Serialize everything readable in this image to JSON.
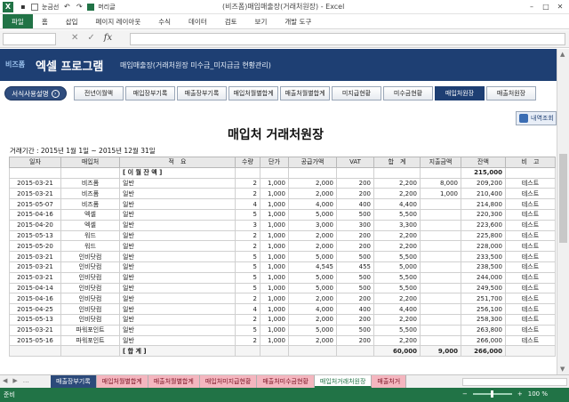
{
  "titlebar": {
    "app_icon": "X",
    "qat_gridlines": "눈금선",
    "qat_header": "머리글",
    "title": "(비즈폼)매입매출장(거래처원장) - Excel",
    "min": "–",
    "restore": "□",
    "close": "✕"
  },
  "ribbon": {
    "tabs": [
      "파일",
      "홈",
      "삽입",
      "페이지 레이아웃",
      "수식",
      "데이터",
      "검토",
      "보기",
      "개발 도구"
    ]
  },
  "formula_bar": {
    "name_box": "",
    "cancel": "✕",
    "enter": "✓",
    "fx": "fx",
    "value": ""
  },
  "banner": {
    "brand": "비즈폼",
    "main": "엑셀 프로그램",
    "subtitle": "매입매출장(거래처원장 미수금_미지급금 현황관리)"
  },
  "nav": {
    "help": "서식사용설명",
    "help_icon": "›",
    "tabs": [
      "전년이월액",
      "매입장부기록",
      "매출장부기록",
      "매입처월별합계",
      "매출처월별합계",
      "미지급현황",
      "미수금현황",
      "매입처원장",
      "매출처원장"
    ],
    "active_index": 7,
    "detail": "내역조회"
  },
  "report": {
    "title": "매입처 거래처원장",
    "period": "거래기간 : 2015년 1월 1일 ~ 2015년 12월 31일",
    "headers": [
      "일자",
      "매입처",
      "적　요",
      "수량",
      "단가",
      "공급가액",
      "VAT",
      "합　계",
      "지출금액",
      "잔액",
      "비　고"
    ],
    "carry": {
      "label": "[ 이 월 잔 액 ]",
      "balance": "215,000"
    },
    "rows": [
      [
        "2015-03-21",
        "비즈폼",
        "일반",
        "2",
        "1,000",
        "2,000",
        "200",
        "2,200",
        "8,000",
        "209,200",
        "테스트"
      ],
      [
        "2015-03-21",
        "비즈폼",
        "일반",
        "2",
        "1,000",
        "2,000",
        "200",
        "2,200",
        "1,000",
        "210,400",
        "테스트"
      ],
      [
        "2015-05-07",
        "비즈폼",
        "일반",
        "4",
        "1,000",
        "4,000",
        "400",
        "4,400",
        "",
        "214,800",
        "테스트"
      ],
      [
        "2015-04-16",
        "엑셀",
        "일반",
        "5",
        "1,000",
        "5,000",
        "500",
        "5,500",
        "",
        "220,300",
        "테스트"
      ],
      [
        "2015-04-20",
        "엑셀",
        "일반",
        "3",
        "1,000",
        "3,000",
        "300",
        "3,300",
        "",
        "223,600",
        "테스트"
      ],
      [
        "2015-05-13",
        "워드",
        "일반",
        "2",
        "1,000",
        "2,000",
        "200",
        "2,200",
        "",
        "225,800",
        "테스트"
      ],
      [
        "2015-05-20",
        "워드",
        "일반",
        "2",
        "1,000",
        "2,000",
        "200",
        "2,200",
        "",
        "228,000",
        "테스트"
      ],
      [
        "2015-03-21",
        "인비닷컴",
        "일반",
        "5",
        "1,000",
        "5,000",
        "500",
        "5,500",
        "",
        "233,500",
        "테스트"
      ],
      [
        "2015-03-21",
        "인비닷컴",
        "일반",
        "5",
        "1,000",
        "4,545",
        "455",
        "5,000",
        "",
        "238,500",
        "테스트"
      ],
      [
        "2015-03-21",
        "인비닷컴",
        "일반",
        "5",
        "1,000",
        "5,000",
        "500",
        "5,500",
        "",
        "244,000",
        "테스트"
      ],
      [
        "2015-04-14",
        "인비닷컴",
        "일반",
        "5",
        "1,000",
        "5,000",
        "500",
        "5,500",
        "",
        "249,500",
        "테스트"
      ],
      [
        "2015-04-16",
        "인비닷컴",
        "일반",
        "2",
        "1,000",
        "2,000",
        "200",
        "2,200",
        "",
        "251,700",
        "테스트"
      ],
      [
        "2015-04-25",
        "인비닷컴",
        "일반",
        "4",
        "1,000",
        "4,000",
        "400",
        "4,400",
        "",
        "256,100",
        "테스트"
      ],
      [
        "2015-05-13",
        "인비닷컴",
        "일반",
        "2",
        "1,000",
        "2,000",
        "200",
        "2,200",
        "",
        "258,300",
        "테스트"
      ],
      [
        "2015-03-21",
        "파워포인트",
        "일반",
        "5",
        "1,000",
        "5,000",
        "500",
        "5,500",
        "",
        "263,800",
        "테스트"
      ],
      [
        "2015-05-16",
        "파워포인트",
        "일반",
        "2",
        "1,000",
        "2,000",
        "200",
        "2,200",
        "",
        "266,000",
        "테스트"
      ]
    ],
    "total": {
      "label": "[ 합 계 ]",
      "sum": "60,000",
      "paid": "9,000",
      "balance": "266,000"
    }
  },
  "sheet_tabs": {
    "nav": [
      "◀",
      "▶",
      "…"
    ],
    "tabs": [
      "매출장부기록",
      "매입처월별합계",
      "매출처월별합계",
      "매입처미지급현황",
      "매출처미수금현황",
      "매입처거래처원장",
      "매출처거"
    ],
    "active_index": 5
  },
  "status": {
    "ready": "준비",
    "zoom": "100 %",
    "zoom_level": 0.5
  }
}
